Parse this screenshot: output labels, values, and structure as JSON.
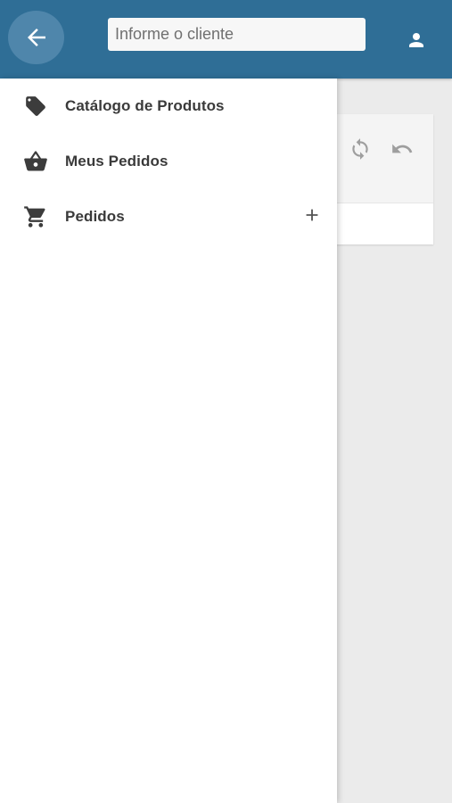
{
  "header": {
    "search": {
      "placeholder": "Informe o cliente",
      "value": ""
    },
    "icons": {
      "back": "arrow-left-icon",
      "user": "person-icon"
    },
    "colors": {
      "appbar": "#2f6e96",
      "back_button": "#4f86ab"
    }
  },
  "drawer": {
    "items": [
      {
        "label": "Catálogo de Produtos",
        "icon": "tag-icon"
      },
      {
        "label": "Meus Pedidos",
        "icon": "basket-icon"
      },
      {
        "label": "Pedidos",
        "icon": "cart-icon",
        "action_icon": "plus-icon"
      }
    ]
  },
  "card": {
    "icons": [
      "sync-icon",
      "undo-icon"
    ]
  }
}
